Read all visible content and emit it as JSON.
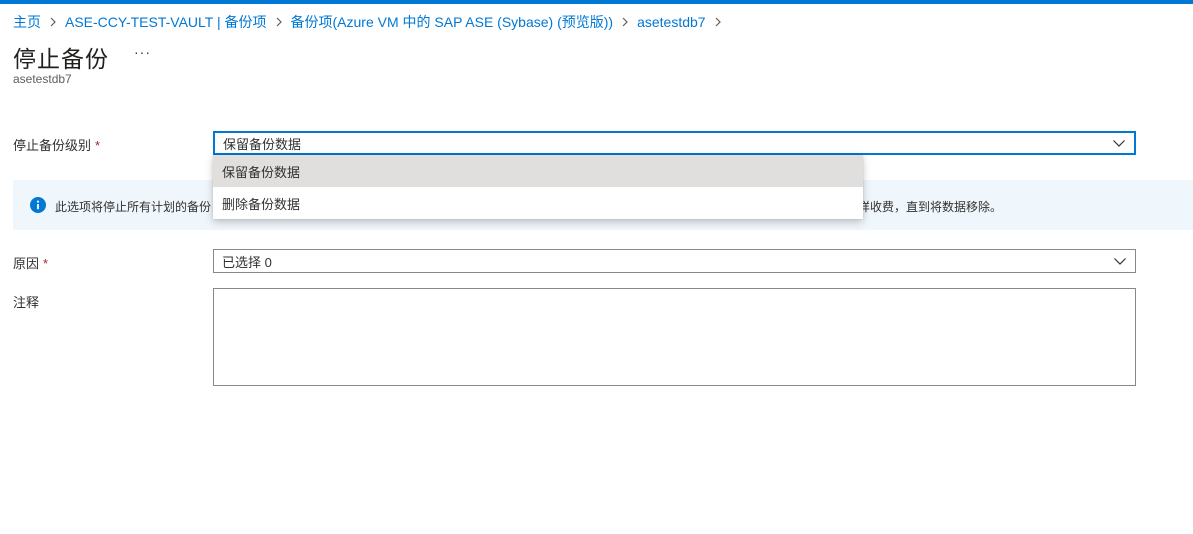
{
  "breadcrumb": [
    "主页",
    "ASE-CCY-TEST-VAULT | 备份项",
    "备份项(Azure VM 中的 SAP ASE (Sybase) (预览版))",
    "asetestdb7"
  ],
  "page": {
    "title": "停止备份",
    "more": "···",
    "subtitle": "asetestdb7"
  },
  "form": {
    "stop_level": {
      "label": "停止备份级别",
      "required": "*",
      "value": "保留备份数据",
      "options": [
        "保留备份数据",
        "删除备份数据"
      ]
    },
    "info": {
      "text_left": "此选项将停止所有计划的备份",
      "text_right": "样收费，直到将数据移除。"
    },
    "reason": {
      "label": "原因",
      "required": "*",
      "value": "已选择 0"
    },
    "comment": {
      "label": "注释"
    }
  },
  "colors": {
    "accent": "#0078d4",
    "info_background": "#eff6fc",
    "required": "#a4262c",
    "selected_option": "#e1dfdd"
  },
  "icons": [
    "chevron-right-icon",
    "chevron-down-icon",
    "info-icon"
  ]
}
